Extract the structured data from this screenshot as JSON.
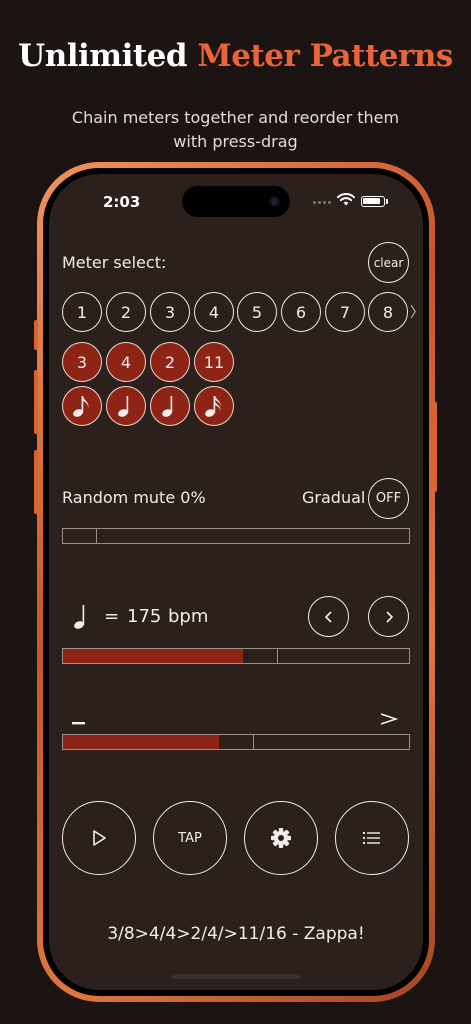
{
  "headline": {
    "part1": "Unlimited",
    "part2": "Meter Patterns"
  },
  "subhead": {
    "line1": "Chain meters together and reorder them",
    "line2": "with press-drag"
  },
  "status_bar": {
    "time": "2:03"
  },
  "meter_select": {
    "label": "Meter select:",
    "clear_label": "clear",
    "numbers": [
      "1",
      "2",
      "3",
      "4",
      "5",
      "6",
      "7",
      "8"
    ],
    "more_glyph": "〉",
    "chain_numerators": [
      "3",
      "4",
      "2",
      "11"
    ],
    "chain_note_icons": [
      "eighth-note-icon",
      "quarter-note-icon",
      "quarter-note-icon",
      "sixteenth-note-icon"
    ]
  },
  "random_mute": {
    "label": "Random mute 0%",
    "gradual_label": "Gradual",
    "toggle_label": "OFF",
    "value_percent": 0
  },
  "tempo": {
    "equals": "=",
    "bpm_value": "175",
    "unit": "bpm",
    "slider_fraction": 0.52
  },
  "accent": {
    "slider_fraction": 0.45
  },
  "controls": {
    "tap_label": "TAP"
  },
  "pattern_text": "3/8>4/4>2/4/>11/16 - Zappa!",
  "colors": {
    "accent": "#8e2415",
    "frame": "#e0773f",
    "headline_orange": "#e8643a",
    "screen_bg": "#2c201d"
  }
}
